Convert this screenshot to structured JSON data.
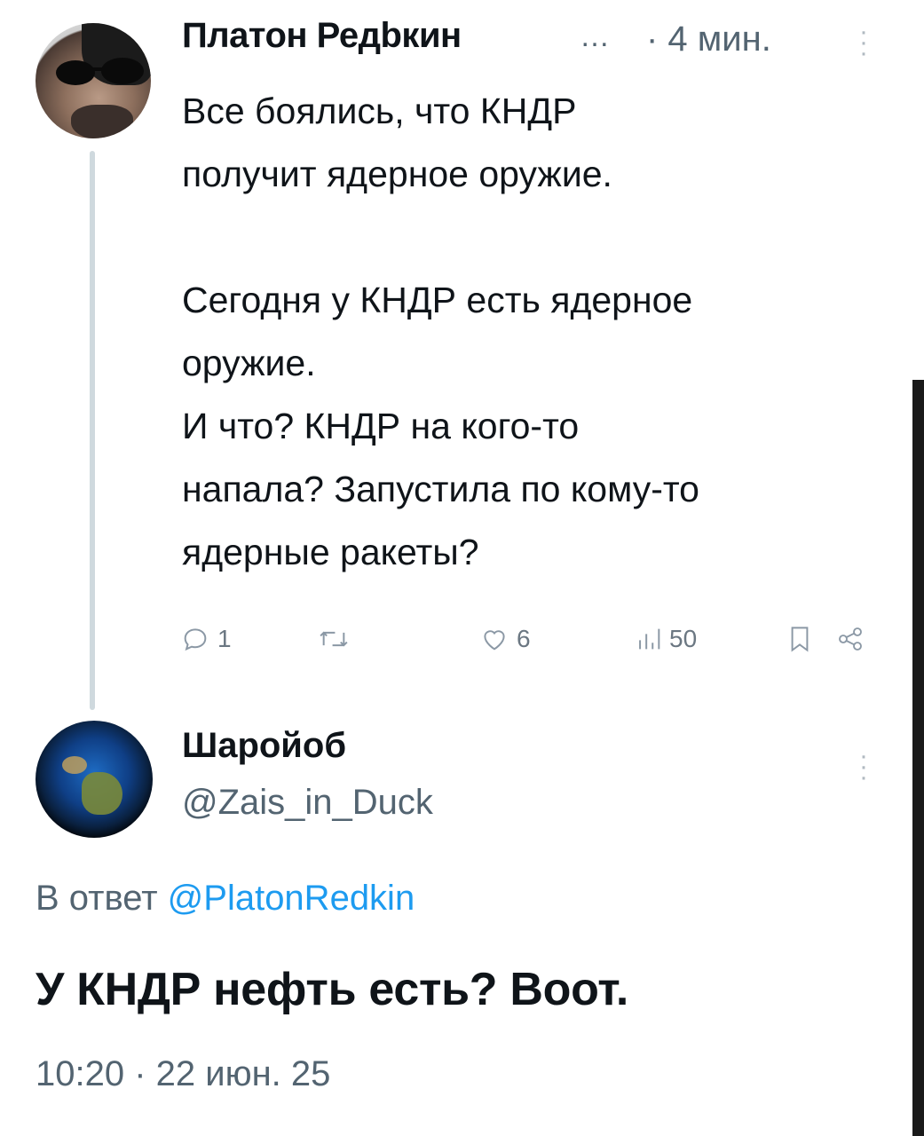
{
  "parent_tweet": {
    "author_name": "Платон Редbкин",
    "ellipsis": "…",
    "time_ago": "· 4 мин.",
    "text": "Все боялись, что КНДР\nполучит ядерное оружие.\n\nСегодня у КНДР есть ядерное\nоружие.\nИ что? КНДР на кого-то\nнапала? Запустила по кому-то\nядерные ракеты?",
    "actions": {
      "reply_count": "1",
      "retweet_count": "",
      "like_count": "6",
      "views_count": "50"
    }
  },
  "reply_tweet": {
    "author_name": "Шаройоб",
    "handle": "@Zais_in_Duck",
    "reply_prefix": "В ответ",
    "reply_mention": "@PlatonRedkin",
    "text": "У КНДР нефть есть? Воот.",
    "timestamp": "10:20 · 22 июн. 25"
  },
  "colors": {
    "text": "#0f1419",
    "secondary": "#536471",
    "link": "#1d9bf0",
    "thread_line": "#cfd9de"
  }
}
